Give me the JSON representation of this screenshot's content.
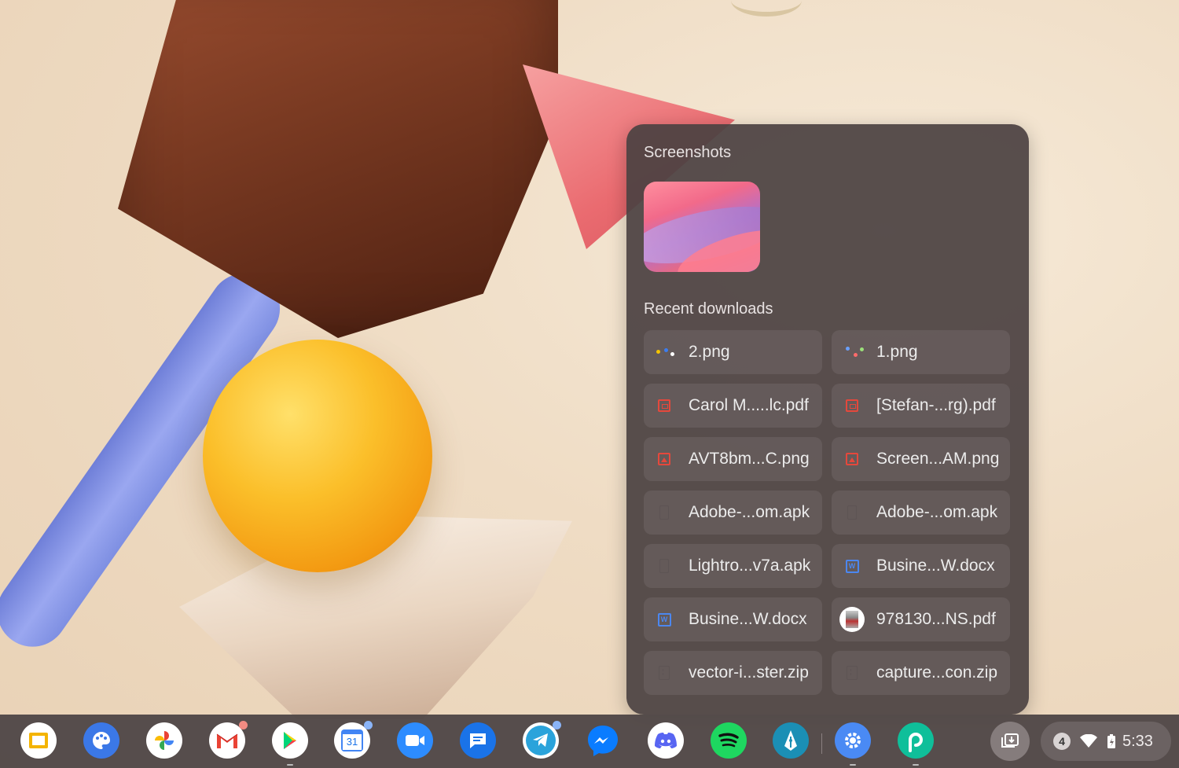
{
  "holding_space": {
    "screenshots_title": "Screenshots",
    "downloads_title": "Recent downloads",
    "downloads": [
      {
        "name": "2.png",
        "icon": "image-thumbnail-icon"
      },
      {
        "name": "1.png",
        "icon": "image-thumbnail-icon"
      },
      {
        "name": "Carol M.....lc.pdf",
        "icon": "pdf-file-icon"
      },
      {
        "name": "[Stefan-...rg).pdf",
        "icon": "pdf-file-icon"
      },
      {
        "name": "AVT8bm...C.png",
        "icon": "image-file-icon"
      },
      {
        "name": "Screen...AM.png",
        "icon": "image-file-icon"
      },
      {
        "name": "Adobe-...om.apk",
        "icon": "generic-file-icon"
      },
      {
        "name": "Adobe-...om.apk",
        "icon": "generic-file-icon"
      },
      {
        "name": "Lightro...v7a.apk",
        "icon": "generic-file-icon"
      },
      {
        "name": "Busine...W.docx",
        "icon": "word-doc-icon"
      },
      {
        "name": "Busine...W.docx",
        "icon": "word-doc-icon"
      },
      {
        "name": "978130...NS.pdf",
        "icon": "book-cover-thumbnail-icon"
      },
      {
        "name": "vector-i...ster.zip",
        "icon": "zip-file-icon"
      },
      {
        "name": "capture...con.zip",
        "icon": "zip-file-icon"
      }
    ]
  },
  "shelf": {
    "apps": [
      "google-slides-icon",
      "canvas-palette-icon",
      "google-photos-icon",
      "gmail-icon",
      "google-play-icon",
      "google-calendar-icon",
      "zoom-icon",
      "google-messages-icon",
      "telegram-icon",
      "messenger-icon",
      "discord-icon",
      "spotify-icon",
      "inkscape-icon",
      "settings-icon",
      "picsart-icon"
    ],
    "calendar_day": "31",
    "notification_count": "4",
    "time": "5:33"
  },
  "colors": {
    "panel_bg": "#4b4242",
    "pdf_red": "#e5483c",
    "doc_blue": "#4b87f0"
  }
}
